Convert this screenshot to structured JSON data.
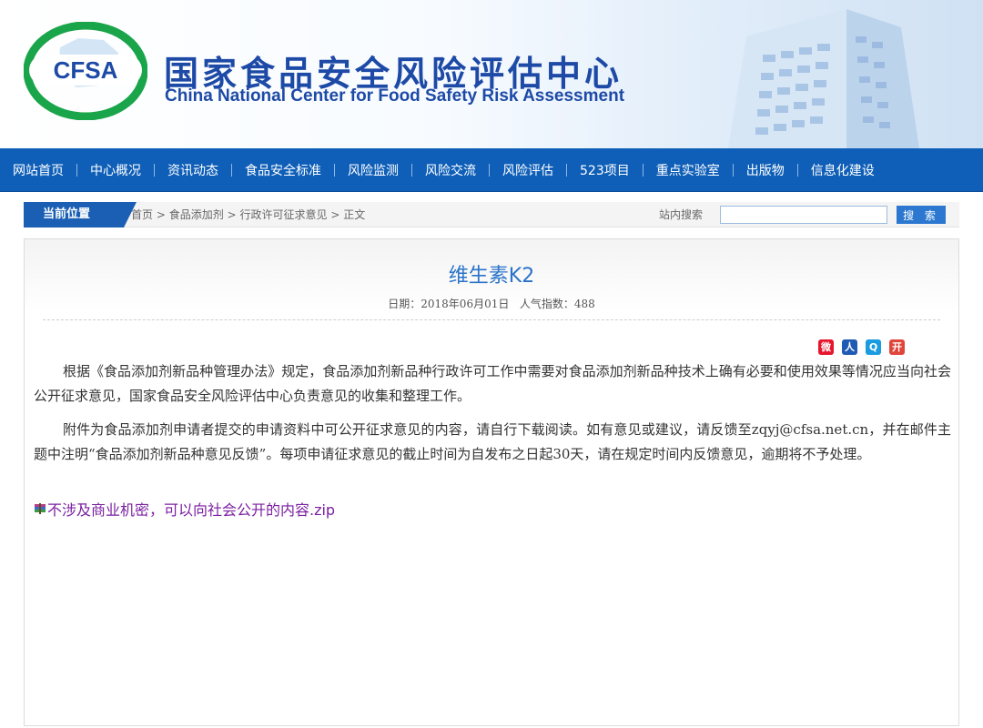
{
  "header": {
    "logo_text": "CFSA",
    "title_cn": "国家食品安全风险评估中心",
    "title_en": "China National Center for Food Safety Risk Assessment"
  },
  "nav": {
    "items": [
      {
        "label": "网站首页"
      },
      {
        "label": "中心概况"
      },
      {
        "label": "资讯动态"
      },
      {
        "label": "食品安全标准"
      },
      {
        "label": "风险监测"
      },
      {
        "label": "风险交流"
      },
      {
        "label": "风险评估"
      },
      {
        "label": "523项目"
      },
      {
        "label": "重点实验室"
      },
      {
        "label": "出版物"
      },
      {
        "label": "信息化建设"
      }
    ]
  },
  "location": {
    "tab_label": "当前位置",
    "crumbs": [
      "首页",
      "食品添加剂",
      "行政许可征求意见",
      "正文"
    ],
    "separator": ">"
  },
  "search": {
    "label": "站内搜索",
    "value": "",
    "button_label": "搜 索"
  },
  "article": {
    "title": "维生素K2",
    "date_label": "日期：",
    "date": "2018年06月01日",
    "views_label": "人气指数：",
    "views": "488",
    "share_icons": [
      "weibo-icon",
      "renren-icon",
      "qzone-icon",
      "kaixin-icon"
    ],
    "paragraphs": [
      "根据《食品添加剂新品种管理办法》规定，食品添加剂新品种行政许可工作中需要对食品添加剂新品种技术上确有必要和使用效果等情况应当向社会公开征求意见，国家食品安全风险评估中心负责意见的收集和整理工作。",
      "附件为食品添加剂申请者提交的申请资料中可公开征求意见的内容，请自行下载阅读。如有意见或建议，请反馈至zqyj@cfsa.net.cn，并在邮件主题中注明“食品添加剂新品种意见反馈”。每项申请征求意见的截止时间为自发布之日起30天，请在规定时间内反馈意见，逾期将不予处理。"
    ],
    "attachment": "不涉及商业机密，可以向社会公开的内容.zip"
  },
  "colors": {
    "nav_bg": "#0f5fb8",
    "title_blue": "#2a73c9",
    "brand_green": "#1aa54a",
    "link_purple": "#7a1fa0"
  }
}
